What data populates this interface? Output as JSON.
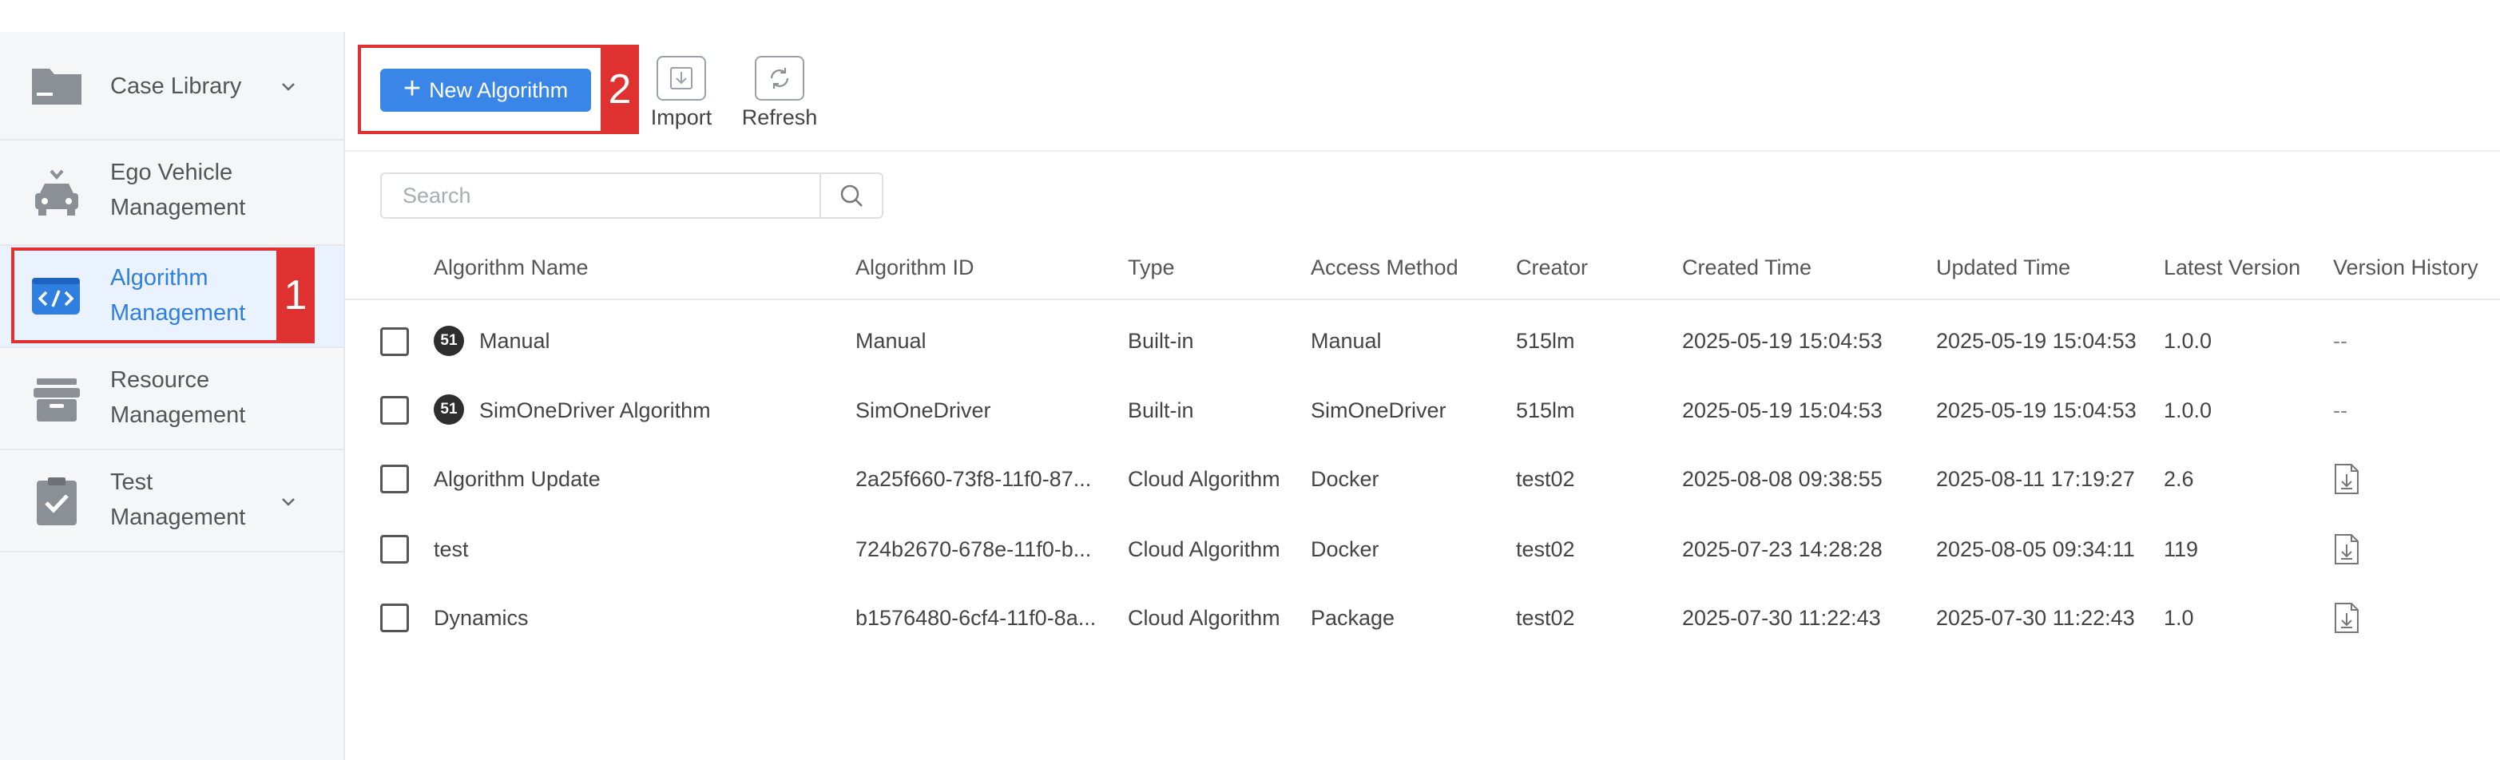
{
  "sidebar": {
    "items": [
      {
        "label": "Case Library",
        "icon": "folder-icon",
        "has_chevron": true
      },
      {
        "label": "Ego Vehicle\nManagement",
        "icon": "vehicle-icon",
        "has_chevron": false
      },
      {
        "label": "Algorithm\nManagement",
        "icon": "code-icon",
        "has_chevron": false,
        "active": true
      },
      {
        "label": "Resource\nManagement",
        "icon": "box-icon",
        "has_chevron": false
      },
      {
        "label": "Test\nManagement",
        "icon": "clipboard-check-icon",
        "has_chevron": true
      }
    ]
  },
  "annotations": {
    "tag1": "1",
    "tag2": "2",
    "color": "#e03131"
  },
  "toolbar": {
    "new_label": "New Algorithm",
    "import_label": "Import",
    "refresh_label": "Refresh",
    "accent": "#3a86e8"
  },
  "search": {
    "placeholder": "Search",
    "value": ""
  },
  "table": {
    "columns": [
      "Algorithm Name",
      "Algorithm ID",
      "Type",
      "Access Method",
      "Creator",
      "Created Time",
      "Updated Time",
      "Latest Version",
      "Version History"
    ],
    "rows": [
      {
        "badge": "51",
        "name": "Manual",
        "id": "Manual",
        "type": "Built-in",
        "access": "Manual",
        "creator": "515lm",
        "created": "2025-05-19 15:04:53",
        "updated": "2025-05-19 15:04:53",
        "version": "1.0.0",
        "history": "--"
      },
      {
        "badge": "51",
        "name": "SimOneDriver Algorithm",
        "id": "SimOneDriver",
        "type": "Built-in",
        "access": "SimOneDriver",
        "creator": "515lm",
        "created": "2025-05-19 15:04:53",
        "updated": "2025-05-19 15:04:53",
        "version": "1.0.0",
        "history": "--"
      },
      {
        "badge": "",
        "name": "Algorithm Update",
        "id": "2a25f660-73f8-11f0-87...",
        "type": "Cloud Algorithm",
        "access": "Docker",
        "creator": "test02",
        "created": "2025-08-08 09:38:55",
        "updated": "2025-08-11 17:19:27",
        "version": "2.6",
        "history": "document-download-icon"
      },
      {
        "badge": "",
        "name": "test",
        "id": "724b2670-678e-11f0-b...",
        "type": "Cloud Algorithm",
        "access": "Docker",
        "creator": "test02",
        "created": "2025-07-23 14:28:28",
        "updated": "2025-08-05 09:34:11",
        "version": "119",
        "history": "document-download-icon"
      },
      {
        "badge": "",
        "name": "Dynamics",
        "id": "b1576480-6cf4-11f0-8a...",
        "type": "Cloud Algorithm",
        "access": "Package",
        "creator": "test02",
        "created": "2025-07-30 11:22:43",
        "updated": "2025-07-30 11:22:43",
        "version": "1.0",
        "history": "document-download-icon"
      }
    ]
  }
}
